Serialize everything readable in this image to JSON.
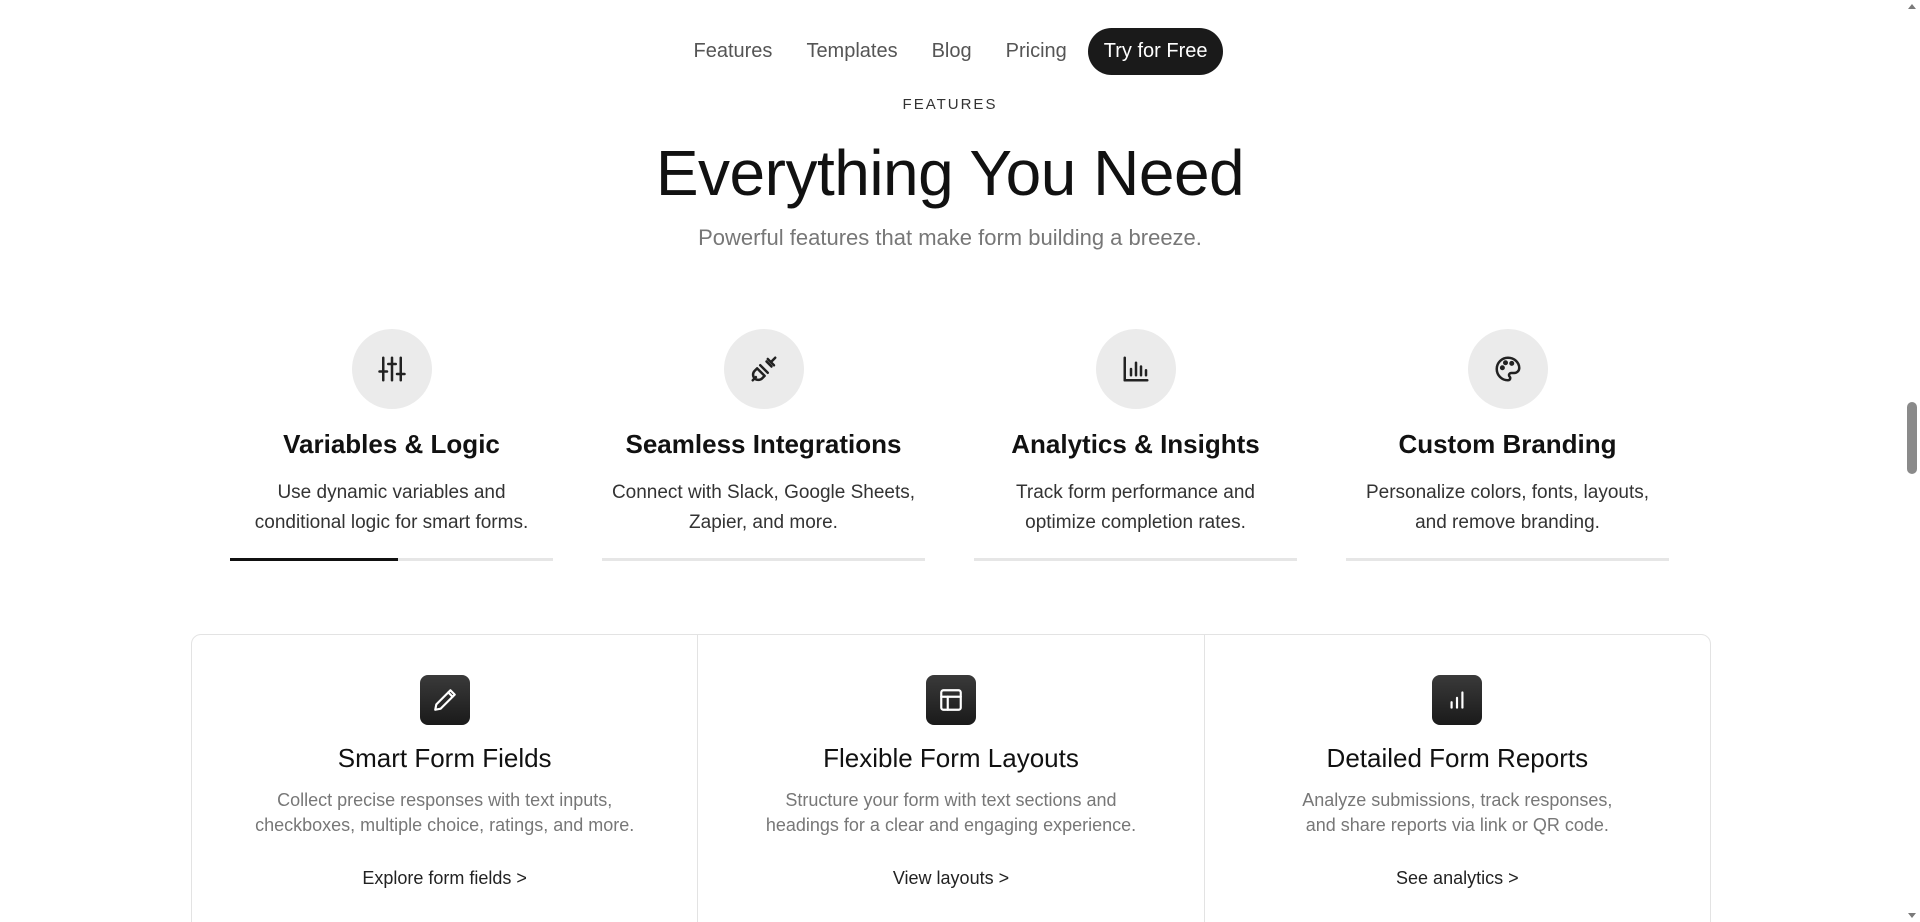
{
  "nav": {
    "links": [
      "Features",
      "Templates",
      "Blog",
      "Pricing"
    ],
    "cta": "Try for Free"
  },
  "hero": {
    "eyebrow": "FEATURES",
    "title": "Everything You Need",
    "subtitle": "Powerful features that make form building a breeze."
  },
  "features": [
    {
      "icon": "sliders-icon",
      "title": "Variables & Logic",
      "desc_line1": "Use dynamic variables and",
      "desc_line2": "conditional logic for smart forms.",
      "progress": 0.52
    },
    {
      "icon": "plug-icon",
      "title": "Seamless Integrations",
      "desc_line1": "Connect with Slack, Google Sheets,",
      "desc_line2": "Zapier, and more.",
      "progress": 0
    },
    {
      "icon": "bar-chart-icon",
      "title": "Analytics & Insights",
      "desc_line1": "Track form performance and",
      "desc_line2": "optimize completion rates.",
      "progress": 0
    },
    {
      "icon": "palette-icon",
      "title": "Custom Branding",
      "desc_line1": "Personalize colors, fonts, layouts,",
      "desc_line2": "and remove branding.",
      "progress": 0
    }
  ],
  "cards": [
    {
      "icon": "pencil-icon",
      "title": "Smart Form Fields",
      "desc_line1": "Collect precise responses with text inputs,",
      "desc_line2": "checkboxes, multiple choice, ratings, and more.",
      "link": "Explore form fields >"
    },
    {
      "icon": "layout-icon",
      "title": "Flexible Form Layouts",
      "desc_line1": "Structure your form with text sections and",
      "desc_line2": "headings for a clear and engaging experience.",
      "link": "View layouts >"
    },
    {
      "icon": "bar-chart-icon",
      "title": "Detailed Form Reports",
      "desc_line1": "Analyze submissions, track responses,",
      "desc_line2": "and share reports via link or QR code.",
      "link": "See analytics >"
    }
  ],
  "colors": {
    "accent": "#1a1a1a",
    "muted": "#777777",
    "icon_bg": "#ebebeb"
  }
}
